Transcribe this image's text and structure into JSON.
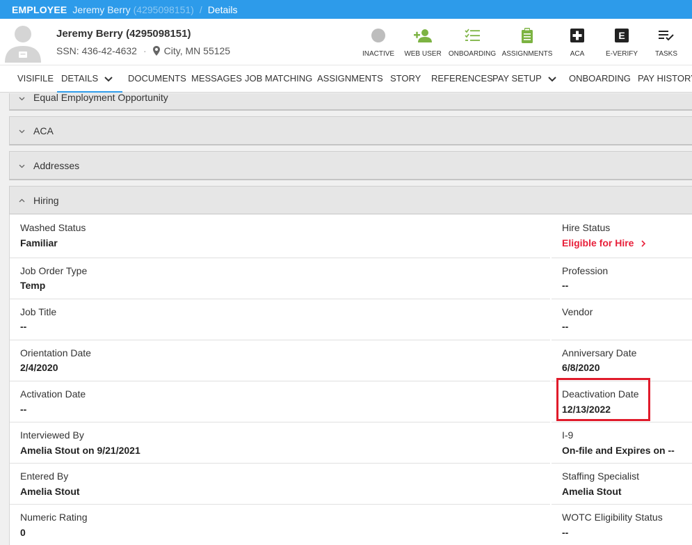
{
  "breadcrumb": {
    "section": "EMPLOYEE",
    "name": "Jeremy Berry",
    "id": "(4295098151)",
    "separator": "/",
    "page": "Details"
  },
  "employee": {
    "full_name": "Jeremy Berry (4295098151)",
    "ssn": "SSN: 436-42-4632",
    "dot": "·",
    "location": "City, MN 55125"
  },
  "actions": [
    {
      "label": "INACTIVE",
      "icon": "status-circle-icon",
      "color": "#bdbdbd"
    },
    {
      "label": "WEB USER",
      "icon": "add-person-icon",
      "color": "#7cb342"
    },
    {
      "label": "ONBOARDING",
      "icon": "checklist-icon",
      "color": "#7cb342"
    },
    {
      "label": "ASSIGNMENTS",
      "icon": "clipboard-icon",
      "color": "#7cb342"
    },
    {
      "label": "ACA",
      "icon": "medical-cross-icon",
      "color": "#222222"
    },
    {
      "label": "E-VERIFY",
      "icon": "e-verify-icon",
      "color": "#222222"
    },
    {
      "label": "TASKS",
      "icon": "tasks-icon",
      "color": "#222222"
    }
  ],
  "everify_letter": "E",
  "tabs": [
    {
      "label": "VISIFILE"
    },
    {
      "label": "DETAILS",
      "active": true
    },
    {
      "label": "DOCUMENTS"
    },
    {
      "label": "MESSAGES"
    },
    {
      "label": "JOB MATCHING"
    },
    {
      "label": "ASSIGNMENTS"
    },
    {
      "label": "STORY"
    },
    {
      "label": "REFERENCES"
    },
    {
      "label": "PAY SETUP"
    },
    {
      "label": "ONBOARDING"
    },
    {
      "label": "PAY HISTORY"
    }
  ],
  "sections": [
    {
      "title": "Equal Employment Opportunity",
      "expanded": false
    },
    {
      "title": "ACA",
      "expanded": false
    },
    {
      "title": "Addresses",
      "expanded": false
    },
    {
      "title": "Hiring",
      "expanded": true
    }
  ],
  "hiring": {
    "left": [
      {
        "label": "Washed Status",
        "value": "Familiar"
      },
      {
        "label": "Job Order Type",
        "value": "Temp"
      },
      {
        "label": "Job Title",
        "value": "--"
      },
      {
        "label": "Orientation Date",
        "value": "2/4/2020"
      },
      {
        "label": "Activation Date",
        "value": "--"
      },
      {
        "label": "Interviewed By",
        "value": "Amelia Stout on 9/21/2021"
      },
      {
        "label": "Entered By",
        "value": "Amelia Stout"
      },
      {
        "label": "Numeric Rating",
        "value": "0"
      }
    ],
    "right": [
      {
        "label": "Hire Status",
        "value": "Eligible for Hire",
        "link": true
      },
      {
        "label": "Profession",
        "value": "--"
      },
      {
        "label": "Vendor",
        "value": "--"
      },
      {
        "label": "Anniversary Date",
        "value": "6/8/2020"
      },
      {
        "label": "Deactivation Date",
        "value": "12/13/2022"
      },
      {
        "label": "I-9",
        "value": "On-file and Expires on --"
      },
      {
        "label": "Staffing Specialist",
        "value": "Amelia Stout"
      },
      {
        "label": "WOTC Eligibility Status",
        "value": "--"
      }
    ]
  },
  "colors": {
    "primary": "#2d9bea",
    "link_red": "#e8203a",
    "highlight_red": "#e01b2b",
    "accent_green": "#7cb342"
  }
}
